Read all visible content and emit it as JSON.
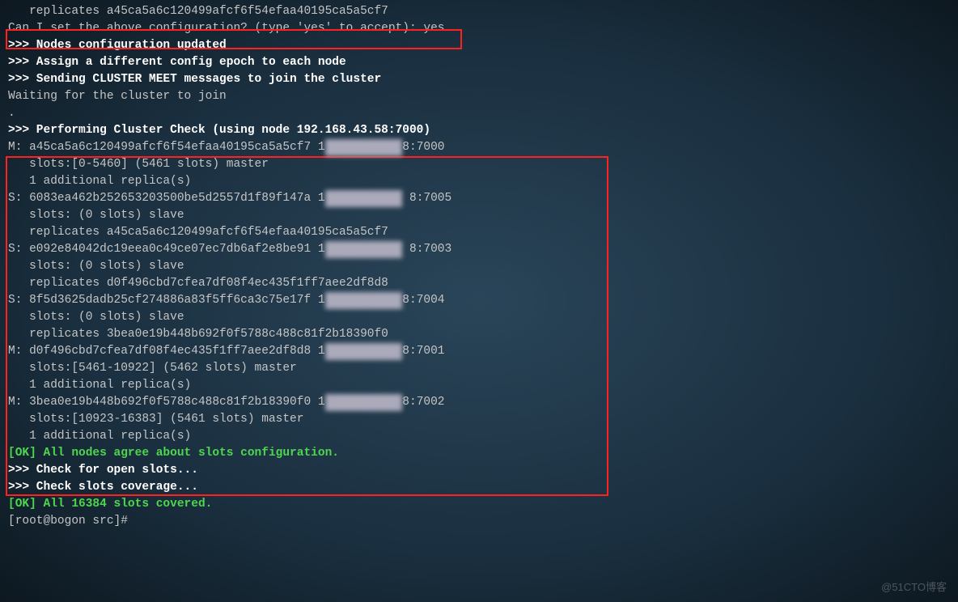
{
  "lines": {
    "l1": "   replicates a45ca5a6c120499afcf6f54efaa40195ca5a5cf7",
    "l2": "Can I set the above configuration? (type 'yes' to accept): yes",
    "l3": ">>> Nodes configuration updated",
    "l4": ">>> Assign a different config epoch to each node",
    "l5": ">>> Sending CLUSTER MEET messages to join the cluster",
    "l6": "Waiting for the cluster to join",
    "l7": ".",
    "l8": ">>> Performing Cluster Check (using node 192.168.43.58:7000)",
    "m1_a": "M: a45ca5a6c120499afcf6f54efaa40195ca5a5cf7 1",
    "m1_port": "8:7000",
    "m1_slots": "   slots:[0-5460] (5461 slots) master",
    "m1_rep": "   1 additional replica(s)",
    "s1_a": "S: 6083ea462b252653203500be5d2557d1f89f147a 1",
    "s1_port": " 8:7005",
    "s1_slots": "   slots: (0 slots) slave",
    "s1_rep": "   replicates a45ca5a6c120499afcf6f54efaa40195ca5a5cf7",
    "s2_a": "S: e092e84042dc19eea0c49ce07ec7db6af2e8be91 1",
    "s2_port": " 8:7003",
    "s2_slots": "   slots: (0 slots) slave",
    "s2_rep": "   replicates d0f496cbd7cfea7df08f4ec435f1ff7aee2df8d8",
    "s3_a": "S: 8f5d3625dadb25cf274886a83f5ff6ca3c75e17f 1",
    "s3_port": "8:7004",
    "s3_slots": "   slots: (0 slots) slave",
    "s3_rep": "   replicates 3bea0e19b448b692f0f5788c488c81f2b18390f0",
    "m2_a": "M: d0f496cbd7cfea7df08f4ec435f1ff7aee2df8d8 1",
    "m2_port": "8:7001",
    "m2_slots": "   slots:[5461-10922] (5462 slots) master",
    "m2_rep": "   1 additional replica(s)",
    "m3_a": "M: 3bea0e19b448b692f0f5788c488c81f2b18390f0 1",
    "m3_port": "8:7002",
    "m3_slots": "   slots:[10923-16383] (5461 slots) master",
    "m3_rep": "   1 additional replica(s)",
    "ok1": "[OK] All nodes agree about slots configuration.",
    "chk1": ">>> Check for open slots...",
    "chk2": ">>> Check slots coverage...",
    "ok2": "[OK] All 16384 slots covered.",
    "prompt": "[root@bogon src]#",
    "blur1": "92.168.43.5",
    "blur2": "92.168.43.5",
    "blur3": "92.168.43.5",
    "blur4": "92.168.43.5",
    "blur5": "92.168.43.5",
    "blur6": "92.168.43.5",
    "watermark": "@51CTO博客"
  },
  "boxes": {
    "box1": "highlight-config-prompt",
    "box2": "highlight-cluster-check"
  }
}
